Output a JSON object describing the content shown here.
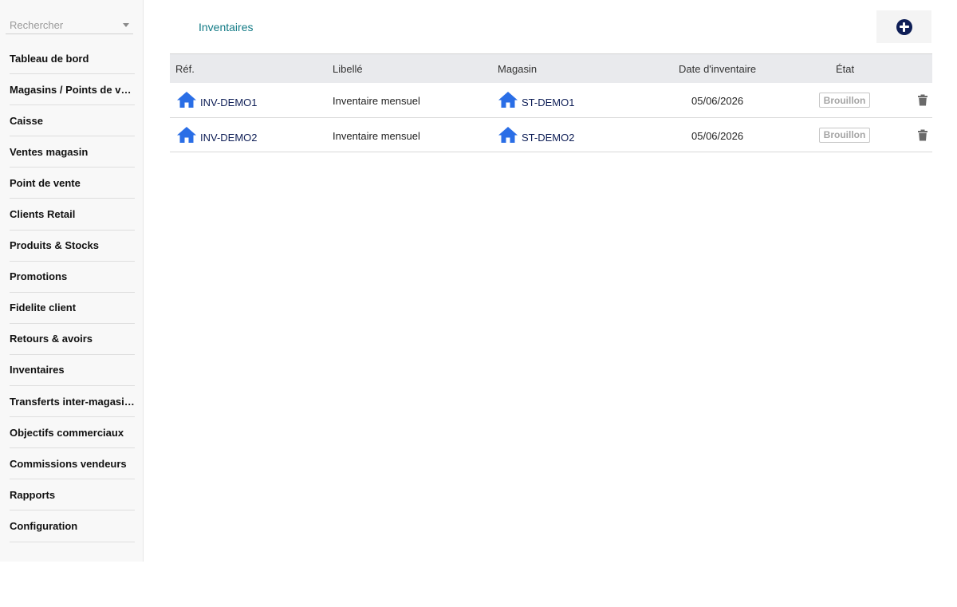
{
  "sidebar": {
    "search": {
      "placeholder": "Rechercher",
      "value": ""
    },
    "items": [
      {
        "label": "Tableau de bord"
      },
      {
        "label": "Magasins / Points de vente"
      },
      {
        "label": "Caisse"
      },
      {
        "label": "Ventes magasin"
      },
      {
        "label": "Point de vente"
      },
      {
        "label": "Clients Retail"
      },
      {
        "label": "Produits & Stocks"
      },
      {
        "label": "Promotions"
      },
      {
        "label": "Fidelite client"
      },
      {
        "label": "Retours & avoirs"
      },
      {
        "label": "Inventaires"
      },
      {
        "label": "Transferts inter-magasins"
      },
      {
        "label": "Objectifs commerciaux"
      },
      {
        "label": "Commissions vendeurs"
      },
      {
        "label": "Rapports"
      },
      {
        "label": "Configuration"
      }
    ]
  },
  "page": {
    "title": "Inventaires",
    "add_icon": "plus-circle-icon"
  },
  "table": {
    "columns": {
      "ref": "Réf.",
      "label": "Libellé",
      "store": "Magasin",
      "date": "Date d'inventaire",
      "state": "État"
    },
    "rows": [
      {
        "ref": "INV-DEMO1",
        "label": "Inventaire mensuel",
        "store": "ST-DEMO1",
        "date": "05/06/2026",
        "state": "Brouillon"
      },
      {
        "ref": "INV-DEMO2",
        "label": "Inventaire mensuel",
        "store": "ST-DEMO2",
        "date": "05/06/2026",
        "state": "Brouillon"
      }
    ]
  },
  "colors": {
    "accent_title": "#137b86",
    "link": "#0e1e56",
    "home_icon": "#2a6ee6",
    "add_button": "#0e1e56",
    "badge_border": "#c6c6c6"
  }
}
